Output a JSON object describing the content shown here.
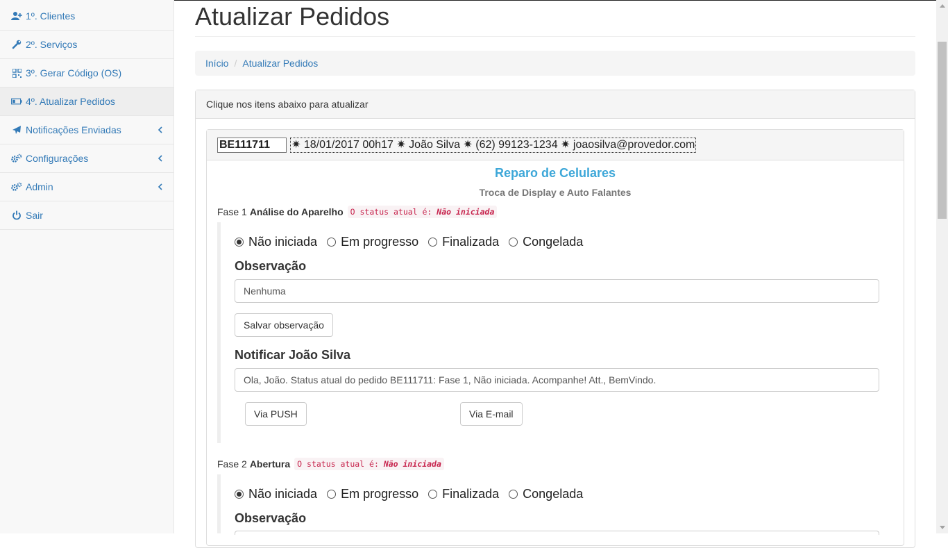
{
  "sidebar": {
    "items": [
      {
        "label": "1º. Clientes",
        "icon": "user-plus-icon"
      },
      {
        "label": "2º. Serviços",
        "icon": "wrench-icon"
      },
      {
        "label": "3º. Gerar Código (OS)",
        "icon": "qrcode-icon"
      },
      {
        "label": "4º. Atualizar Pedidos",
        "icon": "battery-icon",
        "active": true
      },
      {
        "label": "Notificações Enviadas",
        "icon": "plane-icon",
        "submenu": true
      },
      {
        "label": "Configurações",
        "icon": "cogs-icon",
        "submenu": true
      },
      {
        "label": "Admin",
        "icon": "cogs-icon",
        "submenu": true
      },
      {
        "label": "Sair",
        "icon": "power-icon"
      }
    ]
  },
  "page": {
    "title": "Atualizar Pedidos"
  },
  "breadcrumb": {
    "home": "Início",
    "current": "Atualizar Pedidos"
  },
  "panel": {
    "heading": "Clique nos itens abaixo para atualizar"
  },
  "order": {
    "code": "BE111711",
    "info": "✷ 18/01/2017 00h17 ✷ João Silva ✷ (62) 99123-1234 ✷ joaosilva@provedor.com",
    "service": "Reparo de Celulares",
    "service_detail": "Troca de Display e Auto Falantes"
  },
  "status_options": [
    "Não iniciada",
    "Em progresso",
    "Finalizada",
    "Congelada"
  ],
  "phases": [
    {
      "prefix": "Fase 1",
      "name": "Análise do Aparelho",
      "status_prefix": "O status atual é:",
      "status_value": "Não iniciada",
      "selected": 0,
      "obs_label": "Observação",
      "obs_value": "Nenhuma",
      "save_label": "Salvar observação",
      "notify_label": "Notificar João Silva",
      "notify_message": "Ola, João. Status atual do pedido BE111711: Fase 1, Não iniciada. Acompanhe! Att., BemVindo.",
      "push_label": "Via PUSH",
      "email_label": "Via E-mail"
    },
    {
      "prefix": "Fase 2",
      "name": "Abertura",
      "status_prefix": "O status atual é:",
      "status_value": "Não iniciada",
      "selected": 0,
      "obs_label": "Observação"
    }
  ],
  "colors": {
    "link": "#337ab7",
    "service_title": "#3da7d8",
    "status_code": "#c7254e"
  }
}
